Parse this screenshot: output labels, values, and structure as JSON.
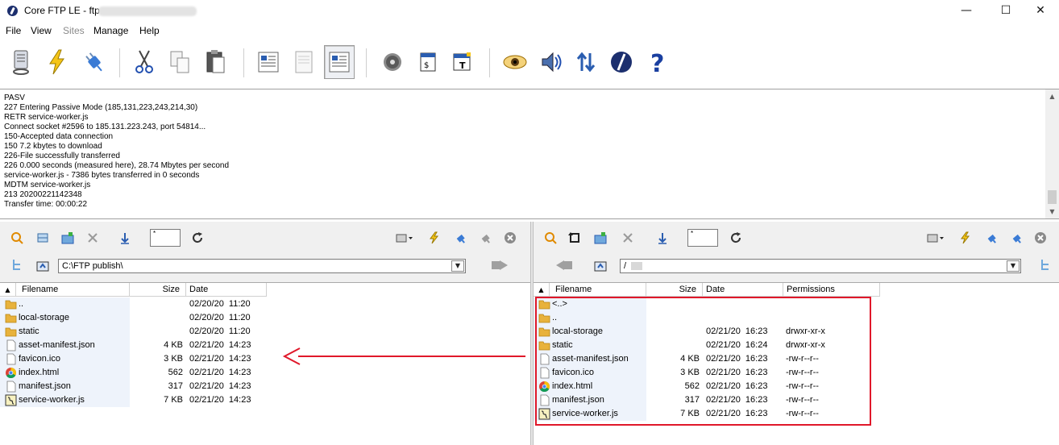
{
  "window": {
    "title": "Core FTP LE - ftp.",
    "controls": {
      "minimize": "—",
      "maximize": "☐",
      "close": "✕"
    }
  },
  "menu": [
    {
      "label": "File",
      "enabled": true
    },
    {
      "label": "View",
      "enabled": true
    },
    {
      "label": "Sites",
      "enabled": false
    },
    {
      "label": "Manage",
      "enabled": true
    },
    {
      "label": "Help",
      "enabled": true
    }
  ],
  "toolbar_icons": [
    "site-manager-icon",
    "quick-connect-icon",
    "disconnect-icon",
    "cut-icon",
    "copy-icon",
    "paste-icon",
    "log-view-icon",
    "blank-page-icon",
    "text-view-icon",
    "settings-icon",
    "scripts-icon",
    "terminal-icon",
    "view-icon",
    "sound-icon",
    "transfer-icon",
    "about-icon",
    "help-icon"
  ],
  "log": [
    "PASV",
    "227 Entering Passive Mode (185,131,223,243,214,30)",
    "RETR service-worker.js",
    "Connect socket #2596 to 185.131.223.243, port 54814...",
    "150-Accepted data connection",
    "150 7.2 kbytes to download",
    "226-File successfully transferred",
    "226 0.000 seconds (measured here), 28.74 Mbytes per second",
    "service-worker.js - 7386 bytes transferred in 0 seconds",
    "MDTM service-worker.js",
    "213 20200221142348",
    "Transfer time: 00:00:22"
  ],
  "local": {
    "filter": "*",
    "path": "C:\\FTP publish\\",
    "columns": {
      "filename": "Filename",
      "size": "Size",
      "date": "Date"
    },
    "files": [
      {
        "name": "..",
        "size": "",
        "date": "02/20/20  11:20",
        "type": "folder"
      },
      {
        "name": "local-storage",
        "size": "",
        "date": "02/20/20  11:20",
        "type": "folder"
      },
      {
        "name": "static",
        "size": "",
        "date": "02/20/20  11:20",
        "type": "folder"
      },
      {
        "name": "asset-manifest.json",
        "size": "4 KB",
        "date": "02/21/20  14:23",
        "type": "file"
      },
      {
        "name": "favicon.ico",
        "size": "3 KB",
        "date": "02/21/20  14:23",
        "type": "file"
      },
      {
        "name": "index.html",
        "size": "562",
        "date": "02/21/20  14:23",
        "type": "html"
      },
      {
        "name": "manifest.json",
        "size": "317",
        "date": "02/21/20  14:23",
        "type": "file"
      },
      {
        "name": "service-worker.js",
        "size": "7 KB",
        "date": "02/21/20  14:23",
        "type": "script"
      }
    ]
  },
  "remote": {
    "filter": "*",
    "path": "/",
    "columns": {
      "filename": "Filename",
      "size": "Size",
      "date": "Date",
      "permissions": "Permissions"
    },
    "files": [
      {
        "name": "<..>",
        "size": "",
        "date": "",
        "perms": "",
        "type": "folder"
      },
      {
        "name": "..",
        "size": "",
        "date": "",
        "perms": "",
        "type": "folder"
      },
      {
        "name": "local-storage",
        "size": "",
        "date": "02/21/20  16:23",
        "perms": "drwxr-xr-x",
        "type": "folder"
      },
      {
        "name": "static",
        "size": "",
        "date": "02/21/20  16:24",
        "perms": "drwxr-xr-x",
        "type": "folder"
      },
      {
        "name": "asset-manifest.json",
        "size": "4 KB",
        "date": "02/21/20  16:23",
        "perms": "-rw-r--r--",
        "type": "file"
      },
      {
        "name": "favicon.ico",
        "size": "3 KB",
        "date": "02/21/20  16:23",
        "perms": "-rw-r--r--",
        "type": "file"
      },
      {
        "name": "index.html",
        "size": "562",
        "date": "02/21/20  16:23",
        "perms": "-rw-r--r--",
        "type": "html"
      },
      {
        "name": "manifest.json",
        "size": "317",
        "date": "02/21/20  16:23",
        "perms": "-rw-r--r--",
        "type": "file"
      },
      {
        "name": "service-worker.js",
        "size": "7 KB",
        "date": "02/21/20  16:23",
        "perms": "-rw-r--r--",
        "type": "script"
      }
    ]
  },
  "colors": {
    "highlight": "#e0182a",
    "folder": "#e8b23c",
    "accent": "#1c2f6e"
  }
}
